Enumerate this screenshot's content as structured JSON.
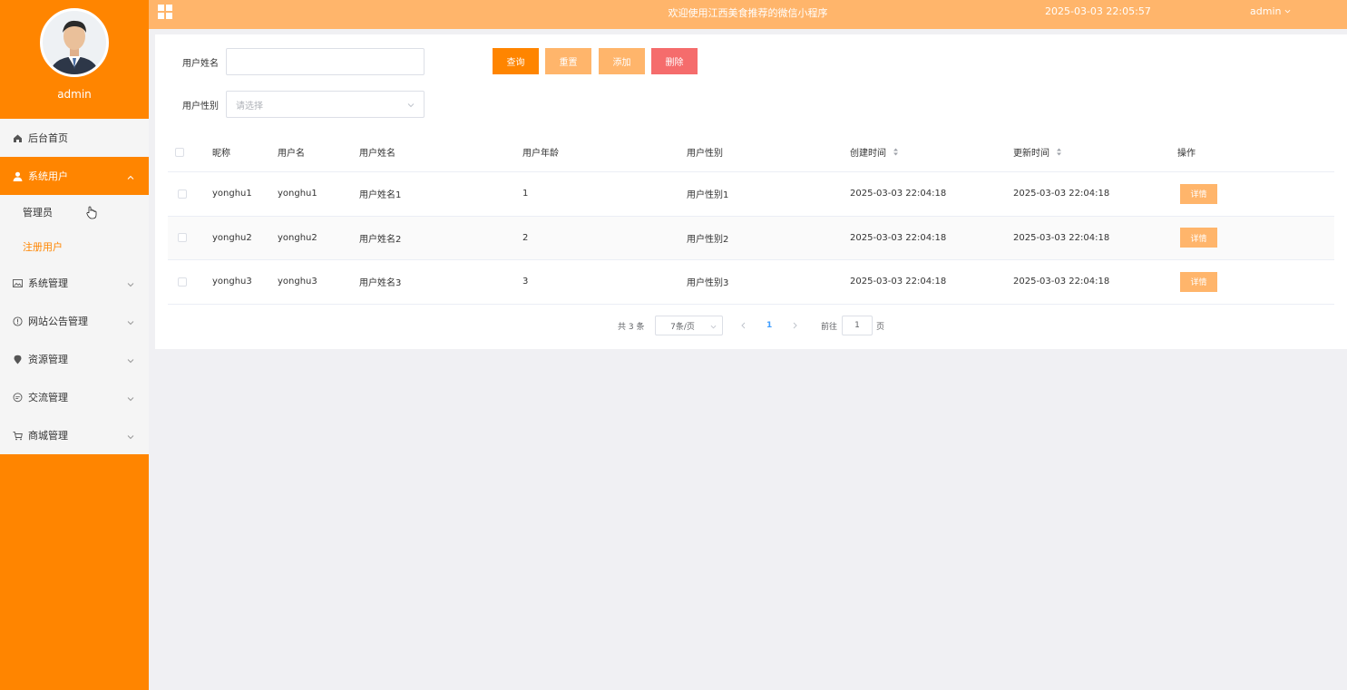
{
  "sidebar": {
    "username": "admin",
    "menu": {
      "home": "后台首页",
      "system_users": "系统用户",
      "sub_admin": "管理员",
      "sub_registered": "注册用户",
      "system_mgmt": "系统管理",
      "announcement_mgmt": "网站公告管理",
      "resource_mgmt": "资源管理",
      "exchange_mgmt": "交流管理",
      "mall_mgmt": "商城管理"
    }
  },
  "topbar": {
    "title": "欢迎使用江西美食推荐的微信小程序",
    "datetime": "2025-03-03 22:05:57",
    "user": "admin"
  },
  "search": {
    "name_label": "用户姓名",
    "name_value": "",
    "gender_label": "用户性别",
    "gender_placeholder": "请选择"
  },
  "buttons": {
    "query": "查询",
    "reset": "重置",
    "add": "添加",
    "delete": "删除"
  },
  "table": {
    "headers": {
      "nickname": "昵称",
      "username": "用户名",
      "realname": "用户姓名",
      "age": "用户年龄",
      "gender": "用户性别",
      "created": "创建时间",
      "updated": "更新时间",
      "actions": "操作"
    },
    "rows": [
      {
        "nickname": "yonghu1",
        "username": "yonghu1",
        "realname": "用户姓名1",
        "age": "1",
        "gender": "用户性别1",
        "created": "2025-03-03 22:04:18",
        "updated": "2025-03-03 22:04:18",
        "detail": "详情"
      },
      {
        "nickname": "yonghu2",
        "username": "yonghu2",
        "realname": "用户姓名2",
        "age": "2",
        "gender": "用户性别2",
        "created": "2025-03-03 22:04:18",
        "updated": "2025-03-03 22:04:18",
        "detail": "详情"
      },
      {
        "nickname": "yonghu3",
        "username": "yonghu3",
        "realname": "用户姓名3",
        "age": "3",
        "gender": "用户性别3",
        "created": "2025-03-03 22:04:18",
        "updated": "2025-03-03 22:04:18",
        "detail": "详情"
      }
    ]
  },
  "pagination": {
    "total": "共 3 条",
    "page_size": "7条/页",
    "current_page": "1",
    "goto_label": "前往",
    "goto_value": "1",
    "goto_suffix": "页"
  },
  "colors": {
    "primary": "#ff8500",
    "light": "#ffb56b",
    "danger": "#f56c6c"
  }
}
